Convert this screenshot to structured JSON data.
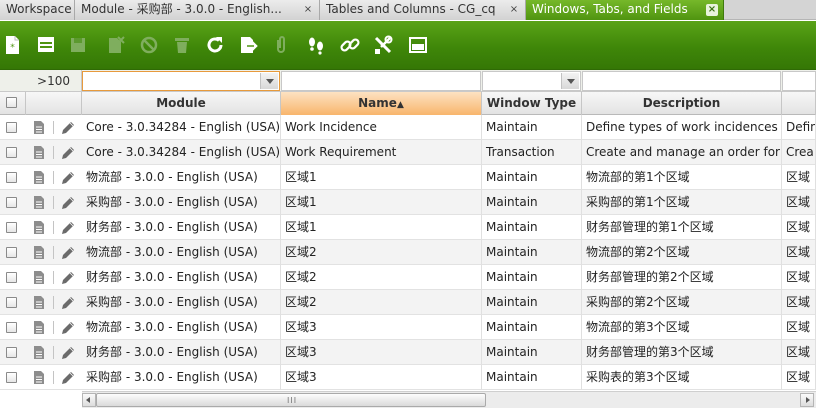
{
  "tabs": [
    {
      "label": "Workspace",
      "closable": false,
      "active": false
    },
    {
      "label": "Module - 采购部 - 3.0.0 - English...",
      "closable": true,
      "active": false
    },
    {
      "label": "Tables and Columns - CG_cq",
      "closable": true,
      "active": false
    },
    {
      "label": "Windows, Tabs, and Fields",
      "closable": true,
      "active": true
    }
  ],
  "tab_close_glyph": "×",
  "toolbar": {
    "buttons": [
      {
        "name": "new-record-icon",
        "enabled": true
      },
      {
        "name": "form-view-icon",
        "enabled": true
      },
      {
        "name": "save-icon",
        "enabled": false
      },
      {
        "name": "delete-record-icon",
        "enabled": false
      },
      {
        "name": "undo-icon",
        "enabled": false
      },
      {
        "name": "trash-icon",
        "enabled": false
      },
      {
        "name": "refresh-icon",
        "enabled": true
      },
      {
        "name": "export-icon",
        "enabled": true
      },
      {
        "name": "attachment-icon",
        "enabled": false
      },
      {
        "name": "audit-trail-icon",
        "enabled": true
      },
      {
        "name": "link-icon",
        "enabled": true
      },
      {
        "name": "tools-icon",
        "enabled": true
      },
      {
        "name": "toggle-view-icon",
        "enabled": true
      }
    ],
    "colors": {
      "bar_top": "#5aa317",
      "bar_bottom": "#357706",
      "enabled_icon": "#ffffff",
      "disabled_icon": "#7fae5e"
    }
  },
  "grid": {
    "record_count": ">100",
    "columns": [
      {
        "label": "",
        "kind": "selector"
      },
      {
        "label": "Module",
        "kind": "text"
      },
      {
        "label": "Name",
        "kind": "text",
        "sorted": "asc",
        "sort_glyph": "▲"
      },
      {
        "label": "Window Type",
        "kind": "text"
      },
      {
        "label": "Description",
        "kind": "text"
      },
      {
        "label": "",
        "kind": "text"
      }
    ],
    "filters": {
      "module": "",
      "name": "",
      "window_type": "",
      "description": "",
      "extra": ""
    },
    "rows": [
      {
        "module": "Core - 3.0.34284 - English (USA)",
        "name": "Work Incidence",
        "window_type": "Maintain",
        "description": "Define types of work incidences that",
        "extra": "Defin"
      },
      {
        "module": "Core - 3.0.34284 - English (USA)",
        "name": "Work Requirement",
        "window_type": "Transaction",
        "description": "Create and manage an order for a pr",
        "extra": "Crea"
      },
      {
        "module": "物流部 - 3.0.0 - English (USA)",
        "name": "区域1",
        "window_type": "Maintain",
        "description": "物流部的第1个区域",
        "extra": "区域"
      },
      {
        "module": "采购部 - 3.0.0 - English (USA)",
        "name": "区域1",
        "window_type": "Maintain",
        "description": "采购部的第1个区域",
        "extra": "区域"
      },
      {
        "module": "财务部 - 3.0.0 - English (USA)",
        "name": "区域1",
        "window_type": "Maintain",
        "description": "财务部管理的第1个区域",
        "extra": "区域"
      },
      {
        "module": "物流部 - 3.0.0 - English (USA)",
        "name": "区域2",
        "window_type": "Maintain",
        "description": "物流部的第2个区域",
        "extra": "区域"
      },
      {
        "module": "财务部 - 3.0.0 - English (USA)",
        "name": "区域2",
        "window_type": "Maintain",
        "description": "财务部管理的第2个区域",
        "extra": "区域"
      },
      {
        "module": "采购部 - 3.0.0 - English (USA)",
        "name": "区域2",
        "window_type": "Maintain",
        "description": "采购部的第2个区域",
        "extra": "区域"
      },
      {
        "module": "物流部 - 3.0.0 - English (USA)",
        "name": "区域3",
        "window_type": "Maintain",
        "description": "物流部的第3个区域",
        "extra": "区域"
      },
      {
        "module": "财务部 - 3.0.0 - English (USA)",
        "name": "区域3",
        "window_type": "Maintain",
        "description": "财务部管理的第3个区域",
        "extra": "区域"
      },
      {
        "module": "采购部 - 3.0.0 - English (USA)",
        "name": "区域3",
        "window_type": "Maintain",
        "description": "采购表的第3个区域",
        "extra": "区域"
      }
    ],
    "row_icons": [
      "document-icon",
      "edit-pencil-icon"
    ],
    "colors": {
      "sorted_header": "#f8b56c",
      "filter_focus": "#e79a3c",
      "alt_row": "#f3f3f3"
    }
  },
  "scrollbar": {
    "grip": "III"
  }
}
